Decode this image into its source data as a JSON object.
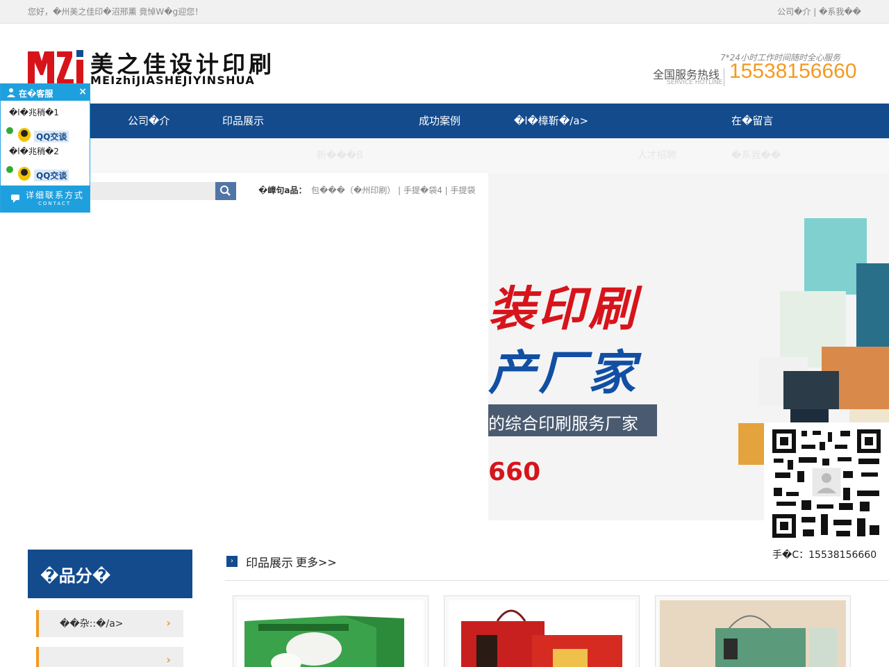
{
  "topbar": {
    "welcome": "您好，�州美之佳印�沼邢薰 竟悼W�g迎您！",
    "links": "公司�介 | �系我��"
  },
  "logo": {
    "cn": "美之佳设计印刷",
    "en": "MEIzhiJIASHEJIYINSHUA"
  },
  "hotline": {
    "service_hours": "7*24小时工作时间随时全心服务",
    "label": "全国服务热线",
    "sub": "SERVICE HOTLINE",
    "number": "15538156660"
  },
  "nav": {
    "items": [
      "公司�介",
      "印品展示",
      "成功案例",
      "�l�樟靳�/a>",
      "在�留言"
    ]
  },
  "subnav": {
    "items": [
      "新���B",
      "人才招聘",
      "�系我��"
    ]
  },
  "search": {
    "placeholder": "",
    "keywords_label": "�嶂句a品：",
    "keywords": "包���（�州印刷）  |  手提�袋4  |  手提袋"
  },
  "banner": {
    "line1": "装印刷",
    "line2": "产厂家",
    "strip": "的综合印刷服务厂家",
    "phone": "660",
    "colors": {
      "red": "#d7141b",
      "blue": "#114fa4"
    }
  },
  "kefu": {
    "title": "在�客服",
    "close": "×",
    "agent1": "�l�兆稍�1",
    "agent2": "�l�兆稍�2",
    "qq_label": "QQ交谈",
    "footer": "详细联系方式",
    "footer_sub": "CONTACT"
  },
  "qr": {
    "caption": "手�C：15538156660"
  },
  "category": {
    "title": "�品分�",
    "items": [
      {
        "label": "��杂::�/a>",
        "arrow": "›"
      },
      {
        "label": "",
        "arrow": "›"
      }
    ]
  },
  "products": {
    "title": "印品展示",
    "more": "更多>>"
  }
}
